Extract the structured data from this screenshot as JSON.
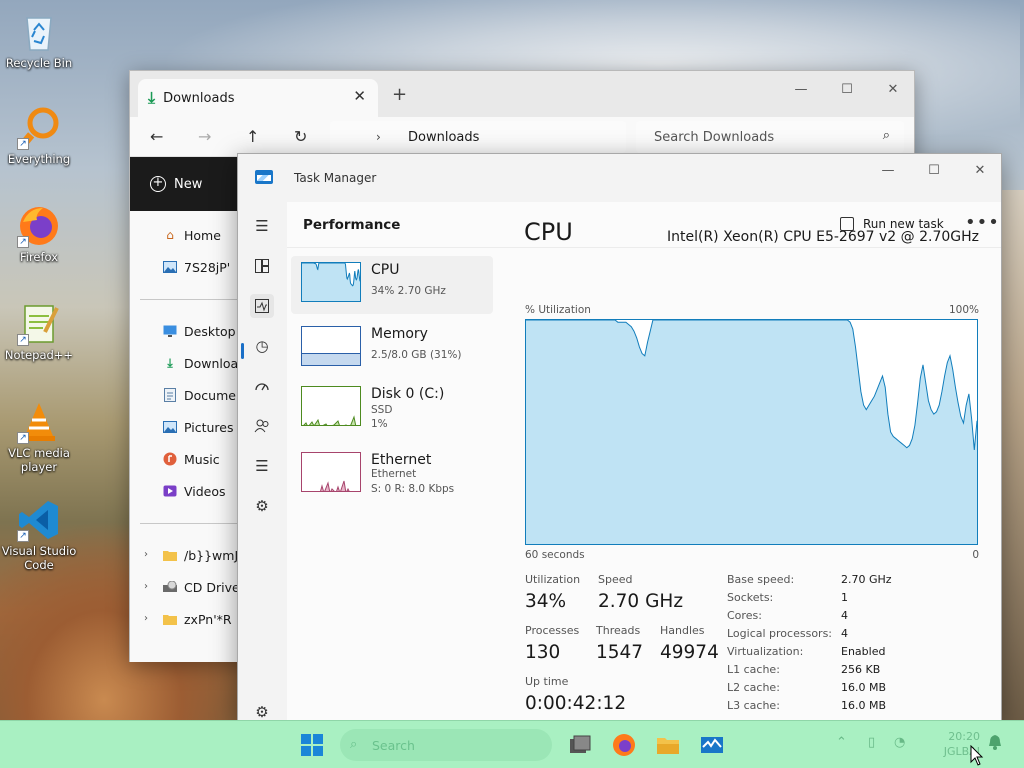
{
  "desktop": {
    "icons": [
      {
        "label": "Recycle Bin"
      },
      {
        "label": "Everything"
      },
      {
        "label": "Firefox"
      },
      {
        "label": "Notepad++"
      },
      {
        "label": "VLC media player"
      },
      {
        "label": "Visual Studio Code"
      }
    ]
  },
  "explorer": {
    "tab_title": "Downloads",
    "tab_close": "✕",
    "new_tab": "+",
    "address_crumb": "Downloads",
    "search_placeholder": "Search Downloads",
    "new_button_label": "New",
    "sidebar": {
      "quick": [
        {
          "label": "Home"
        },
        {
          "label": "7S28jP'"
        }
      ],
      "pinned": [
        {
          "label": "Desktop"
        },
        {
          "label": "Downloads"
        },
        {
          "label": "Documents"
        },
        {
          "label": "Pictures"
        },
        {
          "label": "Music"
        },
        {
          "label": "Videos"
        }
      ],
      "drives": [
        {
          "label": "/b}}wmJ"
        },
        {
          "label": "CD Drive ("
        },
        {
          "label": "zxPn'*R"
        }
      ]
    }
  },
  "task_manager": {
    "window_title": "Task Manager",
    "page_title": "Performance",
    "run_new_task": "Run new task",
    "more": "•••",
    "resources": [
      {
        "name": "CPU",
        "sub1": "34% 2.70 GHz",
        "sub2": "",
        "selected": true
      },
      {
        "name": "Memory",
        "sub1": "2.5/8.0 GB (31%)",
        "sub2": ""
      },
      {
        "name": "Disk 0 (C:)",
        "sub1": "SSD",
        "sub2": "1%"
      },
      {
        "name": "Ethernet",
        "sub1": "Ethernet",
        "sub2": "S: 0 R: 8.0 Kbps"
      }
    ],
    "cpu": {
      "title": "CPU",
      "model": "Intel(R) Xeon(R) CPU E5-2697 v2 @ 2.70GHz",
      "y_label": "% Utilization",
      "y_max_label": "100%",
      "x_left_label": "60 seconds",
      "x_right_label": "0",
      "stats": {
        "utilization_label": "Utilization",
        "utilization": "34%",
        "speed_label": "Speed",
        "speed": "2.70 GHz",
        "processes_label": "Processes",
        "processes": "130",
        "threads_label": "Threads",
        "threads": "1547",
        "handles_label": "Handles",
        "handles": "49974",
        "uptime_label": "Up time",
        "uptime": "0:00:42:12"
      },
      "specs": [
        {
          "k": "Base speed:",
          "v": "2.70 GHz"
        },
        {
          "k": "Sockets:",
          "v": "1"
        },
        {
          "k": "Cores:",
          "v": "4"
        },
        {
          "k": "Logical processors:",
          "v": "4"
        },
        {
          "k": "Virtualization:",
          "v": "Enabled"
        },
        {
          "k": "L1 cache:",
          "v": "256 KB"
        },
        {
          "k": "L2 cache:",
          "v": "16.0 MB"
        },
        {
          "k": "L3 cache:",
          "v": "16.0 MB"
        }
      ],
      "history": [
        100,
        100,
        100,
        100,
        100,
        100,
        100,
        100,
        100,
        100,
        100,
        100,
        100,
        100,
        100,
        100,
        100,
        100,
        100,
        100,
        100,
        100,
        100,
        100,
        100,
        100,
        100,
        100,
        100,
        100,
        100,
        100,
        100,
        100,
        99,
        99,
        99,
        99,
        98,
        97,
        95,
        92,
        88,
        85,
        84,
        90,
        95,
        100,
        100,
        100,
        100,
        100,
        100,
        100,
        100,
        100,
        100,
        100,
        100,
        100,
        100,
        100,
        100,
        100,
        100,
        100,
        100,
        100,
        100,
        100,
        100,
        100,
        100,
        100,
        100,
        100,
        100,
        100,
        100,
        100,
        100,
        100,
        100,
        100,
        100,
        100,
        100,
        100,
        100,
        100,
        100,
        100,
        100,
        100,
        100,
        100,
        100,
        100,
        100,
        100,
        100,
        100,
        100,
        100,
        100,
        100,
        100,
        100,
        100,
        100,
        100,
        100,
        100,
        100,
        100,
        100,
        100,
        100,
        100,
        100,
        99,
        96,
        88,
        78,
        68,
        62,
        60,
        62,
        64,
        66,
        69,
        72,
        75,
        70,
        58,
        50,
        48,
        47,
        46,
        45,
        44,
        43,
        44,
        47,
        53,
        63,
        74,
        80,
        72,
        64,
        60,
        58,
        59,
        62,
        68,
        75,
        81,
        84,
        78,
        70,
        63,
        57,
        54,
        62,
        67,
        56,
        42,
        55
      ],
      "accent": "#117dbb",
      "fill": "#bfe3f4"
    }
  },
  "taskbar": {
    "search_placeholder": "Search",
    "clock_time": "20:20",
    "clock_sub": "JGLBAI"
  }
}
